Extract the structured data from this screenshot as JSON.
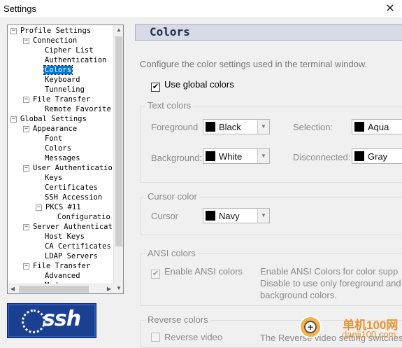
{
  "window": {
    "title": "Settings",
    "close_glyph": "✕"
  },
  "tree": {
    "nodes": [
      {
        "label": "Profile Settings",
        "box": "−"
      },
      {
        "label": "Connection",
        "box": "−"
      },
      {
        "label": "Cipher List"
      },
      {
        "label": "Authentication"
      },
      {
        "label": "Colors",
        "selected": true
      },
      {
        "label": "Keyboard"
      },
      {
        "label": "Tunneling"
      },
      {
        "label": "File Transfer",
        "box": "−"
      },
      {
        "label": "Remote Favorite"
      },
      {
        "label": "Global Settings",
        "box": "−"
      },
      {
        "label": "Appearance",
        "box": "−"
      },
      {
        "label": "Font"
      },
      {
        "label": "Colors"
      },
      {
        "label": "Messages"
      },
      {
        "label": "User Authenticatio",
        "box": "−"
      },
      {
        "label": "Keys"
      },
      {
        "label": "Certificates"
      },
      {
        "label": "SSH Accession"
      },
      {
        "label": "PKCS #11",
        "box": "−"
      },
      {
        "label": "Configuratio"
      },
      {
        "label": "Server Authenticat",
        "box": "−"
      },
      {
        "label": "Host Keys"
      },
      {
        "label": "CA Certificates"
      },
      {
        "label": "LDAP Servers"
      },
      {
        "label": "File Transfer",
        "box": "−"
      },
      {
        "label": "Advanced"
      },
      {
        "label": "Mode"
      }
    ]
  },
  "logo": {
    "text": "ssh"
  },
  "panel": {
    "title": "Colors",
    "description": "Configure the color settings used in the terminal window.",
    "use_global": {
      "label": "Use global colors",
      "checked": "✔"
    },
    "text_colors": {
      "title": "Text colors",
      "foreground": {
        "label": "Foreground",
        "value": "Black"
      },
      "background": {
        "label": "Background:",
        "value": "White"
      },
      "selection": {
        "label": "Selection:",
        "value": "Aqua"
      },
      "disconnected": {
        "label": "Disconnected:",
        "value": "Gray"
      }
    },
    "cursor_color": {
      "title": "Cursor color",
      "cursor": {
        "label": "Cursor",
        "value": "Navy"
      }
    },
    "ansi_colors": {
      "title": "ANSI colors",
      "enable": {
        "label": "Enable ANSI colors",
        "checked": "✔"
      },
      "note_lines": [
        "Enable ANSI Colors for color supp",
        "Disable to use only foreground and",
        "background colors."
      ]
    },
    "reverse_colors": {
      "title": "Reverse colors",
      "reverse_video": {
        "label": "Reverse video"
      },
      "note": "The Reverse video setting switches"
    }
  },
  "watermark": {
    "line1": "单机100网",
    "line2": "danji100.com"
  },
  "colors": {
    "selected_bg": "#0078d7",
    "header_bg": "#d7dbe6",
    "logo_bg": "#1b3f91"
  }
}
